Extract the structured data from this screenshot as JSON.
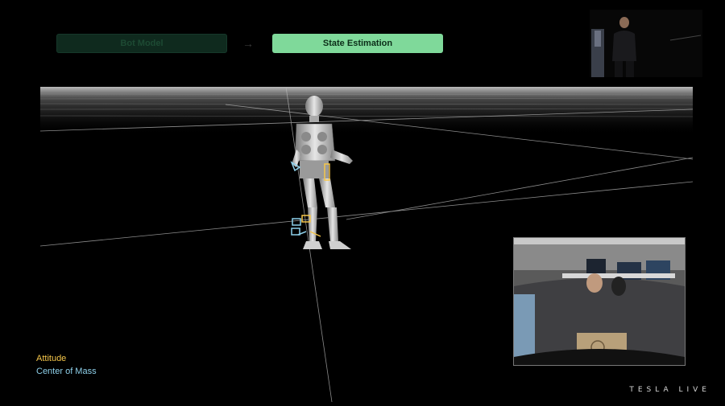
{
  "pipeline": {
    "step_1": "Bot Model",
    "arrow": "→",
    "step_2": "State Estimation"
  },
  "legend": {
    "attitude": "Attitude",
    "center_of_mass": "Center of Mass"
  },
  "brand": {
    "text": "TESLA LIVE"
  },
  "colors": {
    "active_step": "#7fd99a",
    "inactive_step": "#0f2a1e",
    "attitude": "#f5c64a",
    "center_of_mass": "#8ed0ea"
  }
}
